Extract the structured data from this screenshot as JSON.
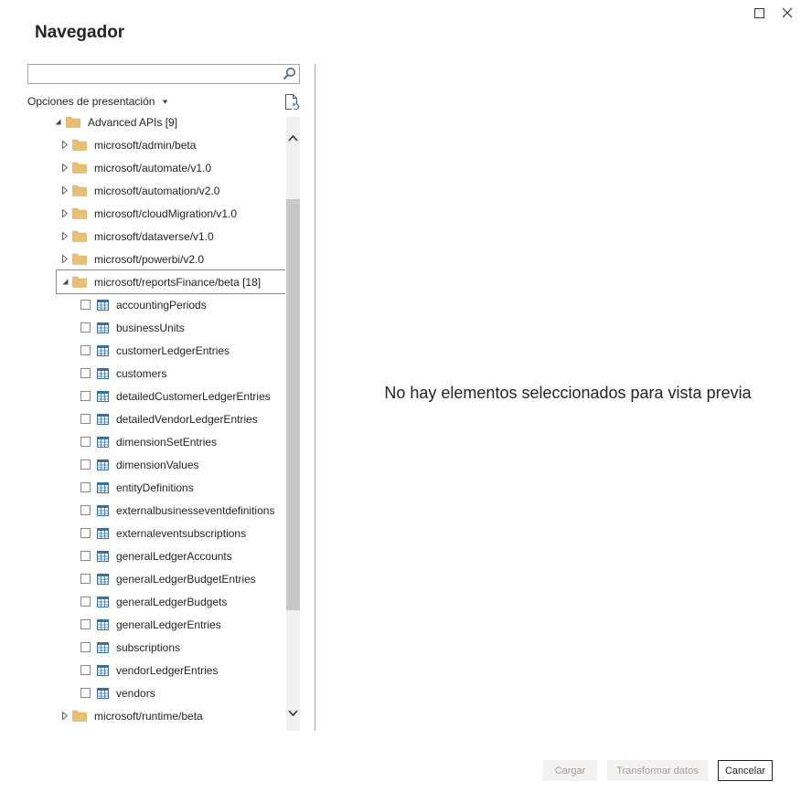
{
  "window": {
    "maximize_icon": "maximize-icon",
    "close_icon": "close-icon"
  },
  "title": "Navegador",
  "search": {
    "value": "",
    "placeholder": ""
  },
  "display_options": {
    "label": "Opciones de presentación"
  },
  "tree": {
    "root": {
      "label": "Advanced APIs [9]"
    },
    "folders_before": [
      "microsoft/admin/beta",
      "microsoft/automate/v1.0",
      "microsoft/automation/v2.0",
      "microsoft/cloudMigration/v1.0",
      "microsoft/dataverse/v1.0",
      "microsoft/powerbi/v2.0"
    ],
    "expanded_folder": {
      "label": "microsoft/reportsFinance/beta [18]"
    },
    "tables": [
      "accountingPeriods",
      "businessUnits",
      "customerLedgerEntries",
      "customers",
      "detailedCustomerLedgerEntries",
      "detailedVendorLedgerEntries",
      "dimensionSetEntries",
      "dimensionValues",
      "entityDefinitions",
      "externalbusinesseventdefinitions",
      "externaleventsubscriptions",
      "generalLedgerAccounts",
      "generalLedgerBudgetEntries",
      "generalLedgerBudgets",
      "generalLedgerEntries",
      "subscriptions",
      "vendorLedgerEntries",
      "vendors"
    ],
    "folders_after": [
      "microsoft/runtime/beta"
    ]
  },
  "preview": {
    "empty_message": "No hay elementos seleccionados para vista previa"
  },
  "footer": {
    "load_label": "Cargar",
    "transform_label": "Transformar datos",
    "cancel_label": "Cancelar"
  },
  "colors": {
    "folder": "#e8c074",
    "table_icon": "#3b6f9e",
    "scroll_thumb": "#c8c8c8"
  }
}
